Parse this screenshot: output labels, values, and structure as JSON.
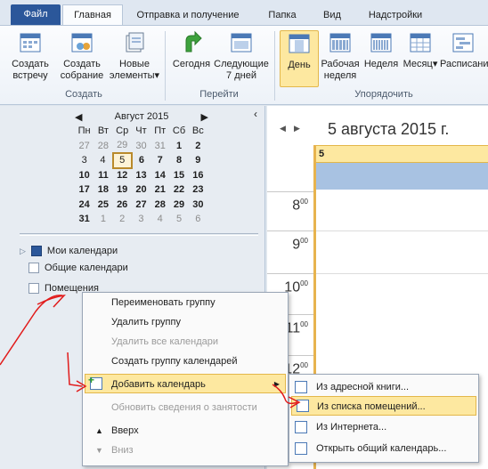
{
  "tabs": [
    "Файл",
    "Главная",
    "Отправка и получение",
    "Папка",
    "Вид",
    "Надстройки"
  ],
  "ribbon": {
    "create": {
      "label": "Создать",
      "buttons": [
        "Создать встречу",
        "Создать собрание",
        "Новые элементы"
      ]
    },
    "goto": {
      "label": "Перейти",
      "buttons": [
        "Сегодня",
        "Следующие 7 дней"
      ]
    },
    "arrange": {
      "label": "Упорядочить",
      "buttons": [
        "День",
        "Рабочая неделя",
        "Неделя",
        "Месяц",
        "Расписание"
      ]
    }
  },
  "mini": {
    "title": "Август 2015",
    "days": [
      "Пн",
      "Вт",
      "Ср",
      "Чт",
      "Пт",
      "Сб",
      "Вс"
    ],
    "weeks": [
      [
        "27",
        "28",
        "29",
        "30",
        "31",
        "1",
        "2"
      ],
      [
        "3",
        "4",
        "5",
        "6",
        "7",
        "8",
        "9"
      ],
      [
        "10",
        "11",
        "12",
        "13",
        "14",
        "15",
        "16"
      ],
      [
        "17",
        "18",
        "19",
        "20",
        "21",
        "22",
        "23"
      ],
      [
        "24",
        "25",
        "26",
        "27",
        "28",
        "29",
        "30"
      ],
      [
        "31",
        "1",
        "2",
        "3",
        "4",
        "5",
        "6"
      ]
    ]
  },
  "calendars": {
    "mine": "Мои календари",
    "shared": "Общие календари",
    "rooms": "Помещения"
  },
  "day_view": {
    "date": "5 августа 2015 г.",
    "day": "5",
    "hours": [
      "8",
      "9",
      "10",
      "11",
      "12"
    ],
    "minutes": "00"
  },
  "context_menu": [
    "Переименовать группу",
    "Удалить группу",
    "Удалить все календари",
    "Создать группу календарей",
    "Добавить календарь",
    "Обновить сведения о занятости",
    "Вверх",
    "Вниз"
  ],
  "submenu": [
    "Из адресной книги...",
    "Из списка помещений...",
    "Из Интернета...",
    "Открыть общий календарь..."
  ],
  "colors": {
    "accent": "#2b579a",
    "highlight": "#fde8a0",
    "annotation": "#e11b1b"
  }
}
